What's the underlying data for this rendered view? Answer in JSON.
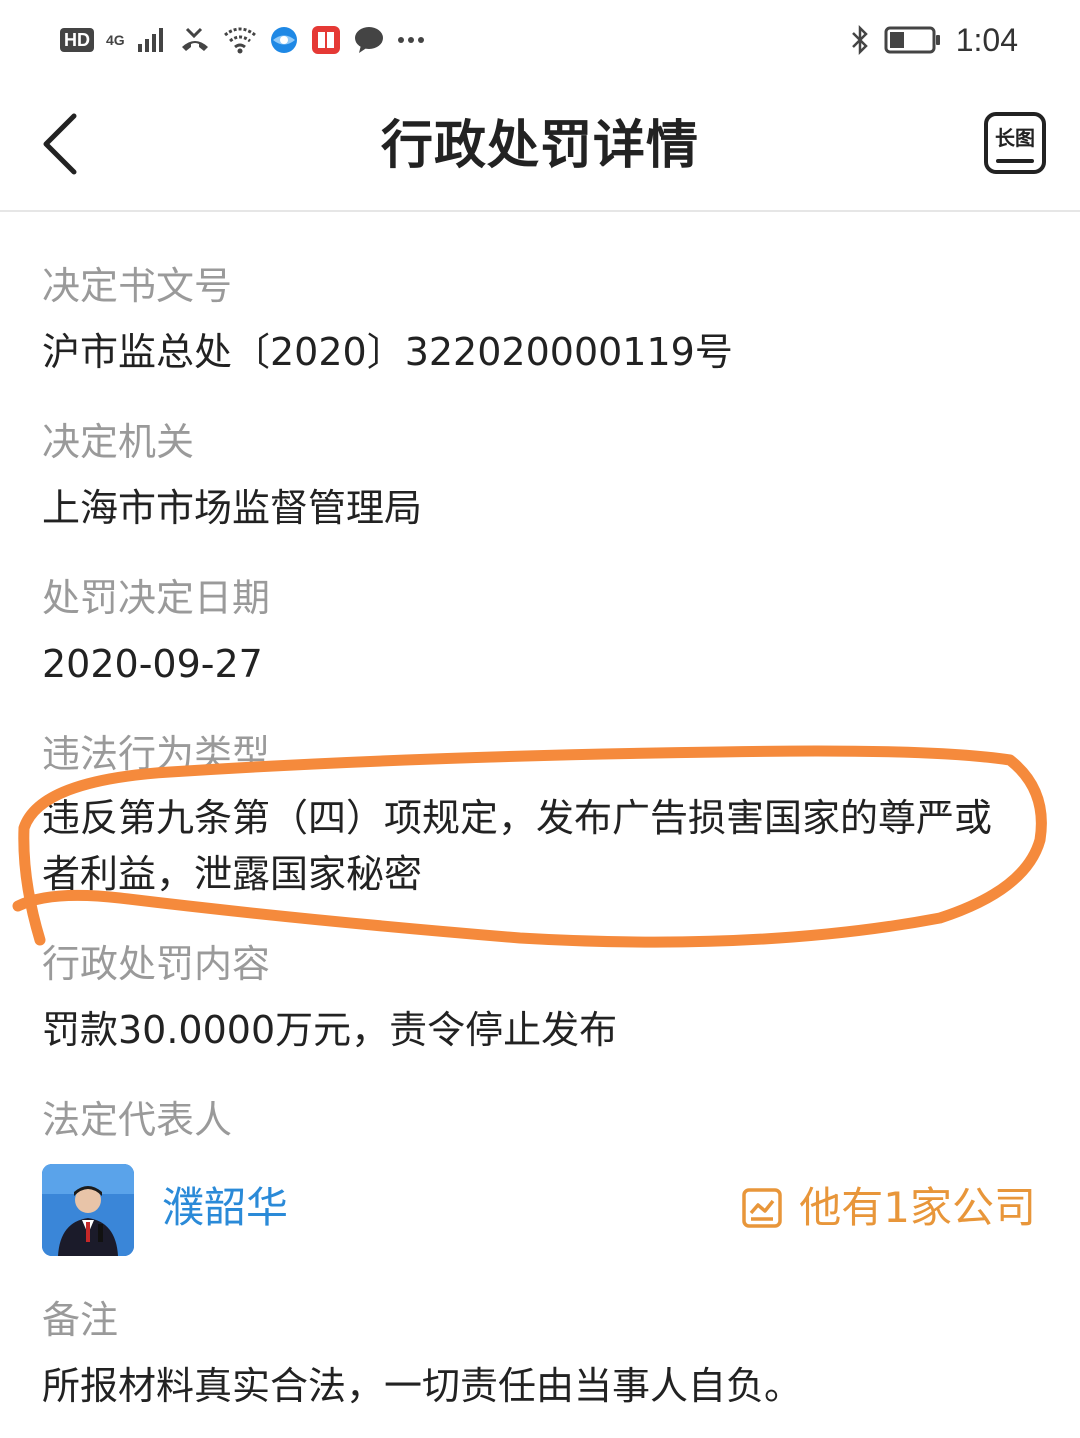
{
  "status_bar": {
    "hd": "HD",
    "network": "4G",
    "time": "1:04",
    "icons": [
      "signal-icon",
      "missed-call-icon",
      "wifi-icon",
      "browser-icon",
      "book-app-icon",
      "message-icon",
      "more-dots-icon",
      "bluetooth-icon",
      "battery-icon"
    ]
  },
  "nav": {
    "title": "行政处罚详情",
    "long_image_label": "长图"
  },
  "fields": {
    "doc_number": {
      "label": "决定书文号",
      "value": "沪市监总处〔2020〕322020000119号"
    },
    "authority": {
      "label": "决定机关",
      "value": "上海市市场监督管理局"
    },
    "decision_date": {
      "label": "处罚决定日期",
      "value": "2020-09-27"
    },
    "violation_type": {
      "label": "违法行为类型",
      "value": "违反第九条第（四）项规定，发布广告损害国家的尊严或者利益，泄露国家秘密"
    },
    "penalty_content": {
      "label": "行政处罚内容",
      "value": "罚款30.0000万元，责令停止发布"
    },
    "legal_rep": {
      "label": "法定代表人",
      "name": "濮韶华",
      "companies_link": "他有1家公司"
    },
    "remarks": {
      "label": "备注",
      "value": "所报材料真实合法，一切责任由当事人自负。"
    }
  },
  "colors": {
    "label_gray": "#9a9a9a",
    "link_blue": "#2a8ad8",
    "accent_orange": "#e8963a",
    "annotation_orange": "#f58a3c"
  }
}
